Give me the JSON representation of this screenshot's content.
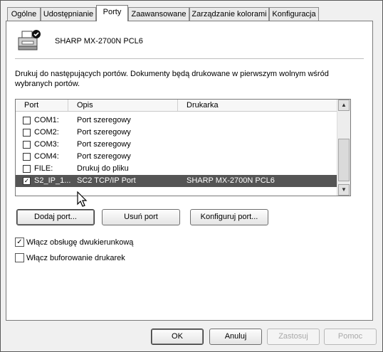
{
  "tabs": [
    {
      "label": "Ogólne"
    },
    {
      "label": "Udostępnianie"
    },
    {
      "label": "Porty"
    },
    {
      "label": "Zaawansowane"
    },
    {
      "label": "Zarządzanie kolorami"
    },
    {
      "label": "Konfiguracja"
    }
  ],
  "active_tab": "Porty",
  "printer": {
    "name": "SHARP MX-2700N PCL6",
    "icon": "printer-icon"
  },
  "description": "Drukuj do następujących portów. Dokumenty będą drukowane w pierwszym wolnym wśród wybranych portów.",
  "port_list": {
    "columns": [
      "Port",
      "Opis",
      "Drukarka"
    ],
    "rows": [
      {
        "port": "COM1:",
        "desc": "Port szeregowy",
        "printer": "",
        "checked": false,
        "selected": false
      },
      {
        "port": "COM2:",
        "desc": "Port szeregowy",
        "printer": "",
        "checked": false,
        "selected": false
      },
      {
        "port": "COM3:",
        "desc": "Port szeregowy",
        "printer": "",
        "checked": false,
        "selected": false
      },
      {
        "port": "COM4:",
        "desc": "Port szeregowy",
        "printer": "",
        "checked": false,
        "selected": false
      },
      {
        "port": "FILE:",
        "desc": "Drukuj do pliku",
        "printer": "",
        "checked": false,
        "selected": false
      },
      {
        "port": "S2_IP_1...",
        "desc": "SC2 TCP/IP Port",
        "printer": "SHARP MX-2700N PCL6",
        "checked": true,
        "selected": true
      }
    ]
  },
  "port_buttons": {
    "add": "Dodaj port...",
    "remove": "Usuń port",
    "configure": "Konfiguruj port..."
  },
  "options": {
    "bidirectional": {
      "label": "Włącz obsługę dwukierunkową",
      "checked": true
    },
    "pooling": {
      "label": "Włącz buforowanie drukarek",
      "checked": false
    }
  },
  "dialog_buttons": {
    "ok": "OK",
    "cancel": "Anuluj",
    "apply": "Zastosuj",
    "help": "Pomoc"
  },
  "colors": {
    "selection": "#555555",
    "panel": "#ffffff",
    "background": "#f0f0f0"
  }
}
